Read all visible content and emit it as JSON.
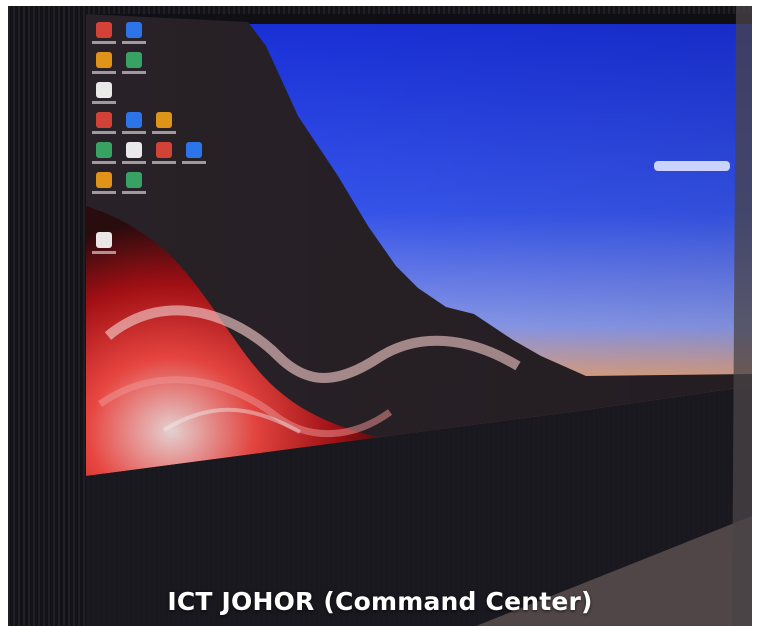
{
  "caption": "ICT JOHOR (Command Center)",
  "desktop_icons": [
    "app-icon",
    "app-icon",
    "app-icon",
    "app-icon",
    "app-icon",
    "app-icon",
    "app-icon",
    "app-icon",
    "app-icon",
    "app-icon",
    "app-icon",
    "app-icon",
    "app-icon",
    "app-icon",
    "app-icon"
  ],
  "colors": {
    "sky_top": "#1f3cf0",
    "sky_bottom": "#7d9bff",
    "sunset": "#f59a5a",
    "mountain": "#2d2428",
    "swirl_red": "#e0241e",
    "wall": "#17161c"
  }
}
